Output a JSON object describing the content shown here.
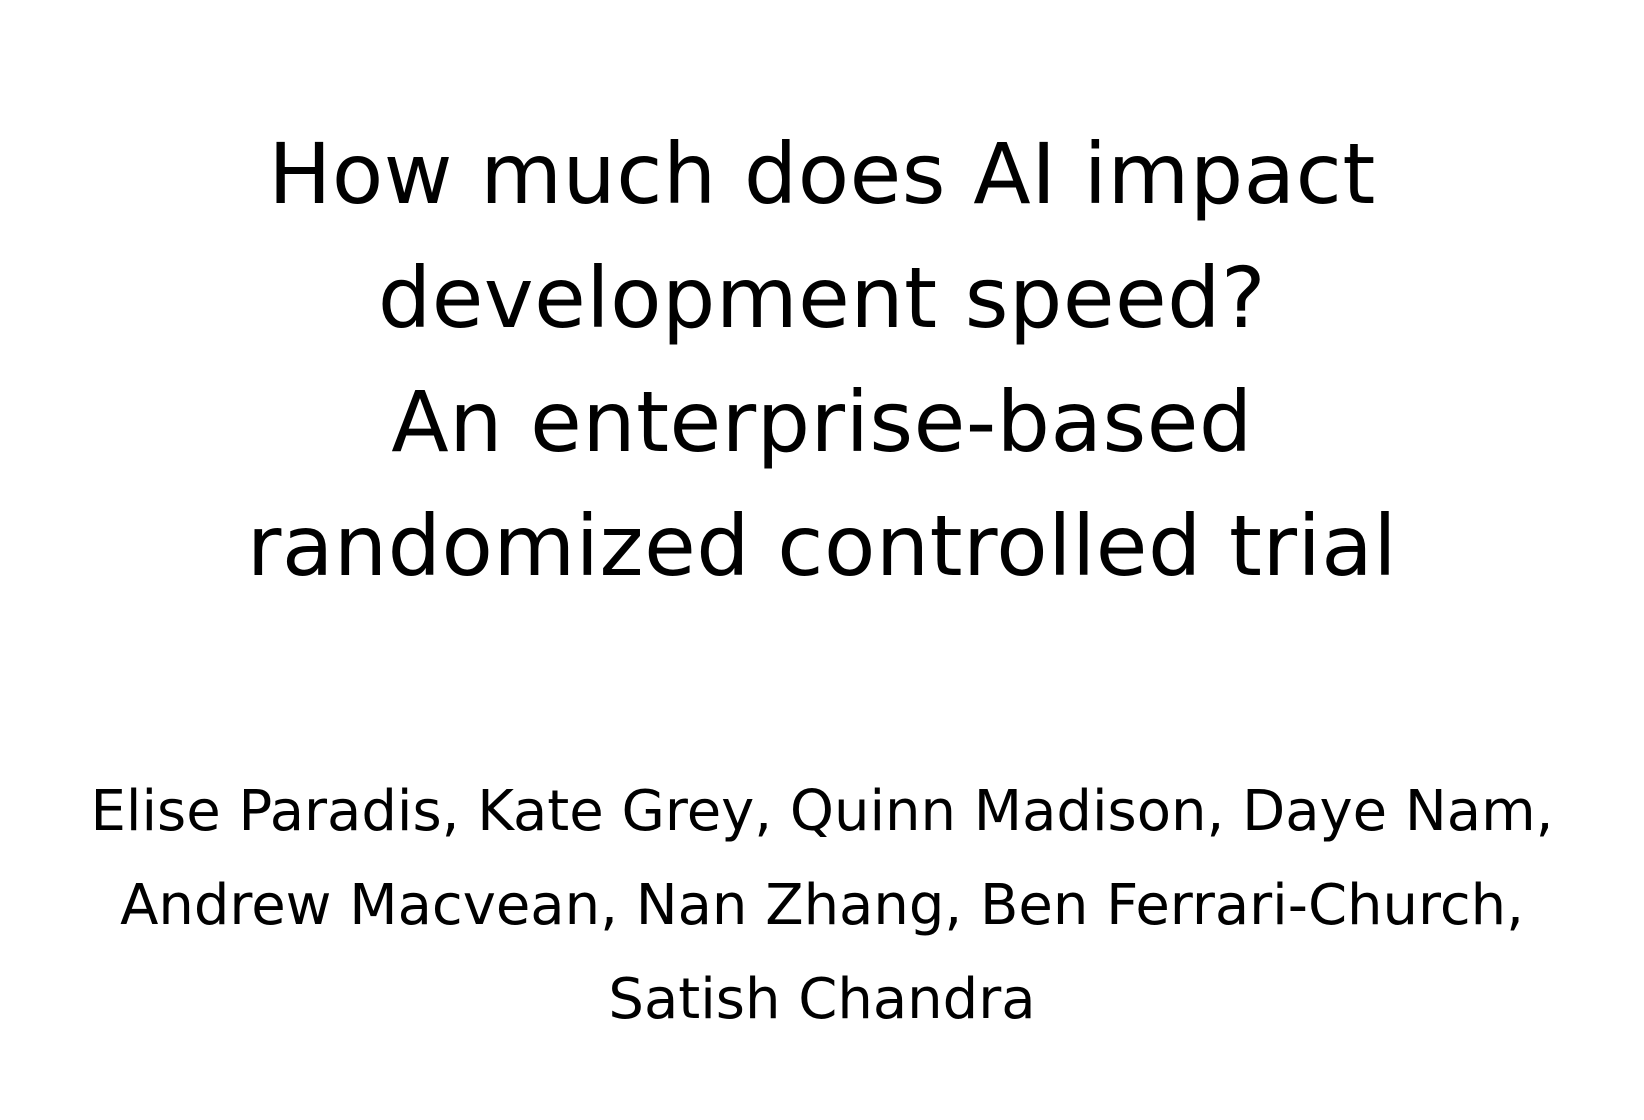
{
  "title": {
    "lines": [
      "How much does AI impact",
      "development speed?",
      "An enterprise-based",
      "randomized controlled trial"
    ]
  },
  "authors": {
    "lines": [
      "Elise Paradis, Kate Grey, Quinn Madison, Daye Nam,",
      "Andrew Macvean, Nan Zhang, Ben Ferrari-Church,",
      "Satish Chandra"
    ]
  }
}
